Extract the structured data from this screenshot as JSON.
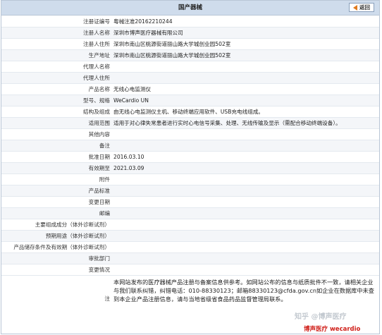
{
  "header": {
    "title": "国产器械",
    "back_label": "返回"
  },
  "rows": [
    {
      "label": "注册证编号",
      "value": "粤械注准20162210244"
    },
    {
      "label": "注册人名称",
      "value": "深圳市博声医疗器械有限公司"
    },
    {
      "label": "注册人住所",
      "value": "深圳市南山区桃源街道丽山路大学城创业园502室"
    },
    {
      "label": "生产地址",
      "value": "深圳市南山区桃源街道丽山路大学城创业园502室"
    },
    {
      "label": "代理人名称",
      "value": ""
    },
    {
      "label": "代理人住所",
      "value": ""
    },
    {
      "label": "产品名称",
      "value": "无线心电监测仪"
    },
    {
      "label": "型号、规格",
      "value": "WeCardio UN"
    },
    {
      "label": "结构及组成",
      "value": "由无线心电监测仪主机、移动终端应用软件、USB充电线组成。"
    },
    {
      "label": "适用范围",
      "value": "适用于对心律失常患者进行实时心电信号采集、处理、无线传输及显示（需配合移动终端设备）。"
    },
    {
      "label": "其他内容",
      "value": ""
    },
    {
      "label": "备注",
      "value": ""
    },
    {
      "label": "批准日期",
      "value": "2016.03.10"
    },
    {
      "label": "有效期至",
      "value": "2021.03.09"
    },
    {
      "label": "附件",
      "value": ""
    },
    {
      "label": "产品标准",
      "value": ""
    },
    {
      "label": "变更日期",
      "value": ""
    },
    {
      "label": "邮编",
      "value": ""
    },
    {
      "label": "主要组成成分（体外诊断试剂）",
      "value": ""
    },
    {
      "label": "预期用途（体外诊断试剂）",
      "value": ""
    },
    {
      "label": "产品储存条件及有效期（体外诊断试剂）",
      "value": ""
    },
    {
      "label": "审批部门",
      "value": ""
    },
    {
      "label": "变更情况",
      "value": ""
    }
  ],
  "note": {
    "label": "注",
    "text": "本网站发布的医疗器械产品注册与备案信息供参考。如网站公布的信息与纸质批件不一致，请相关企业与我们联系纠错，纠错电话：010-88330123；邮箱88330123@cfda.gov.cn如企业在数据库中未查到本企业产品注册信息，请与当地省级省食品药品监督管理局联系。"
  },
  "watermark": {
    "line1": "知乎 @博声医疗",
    "line2": "博声医疗 wecardio"
  }
}
